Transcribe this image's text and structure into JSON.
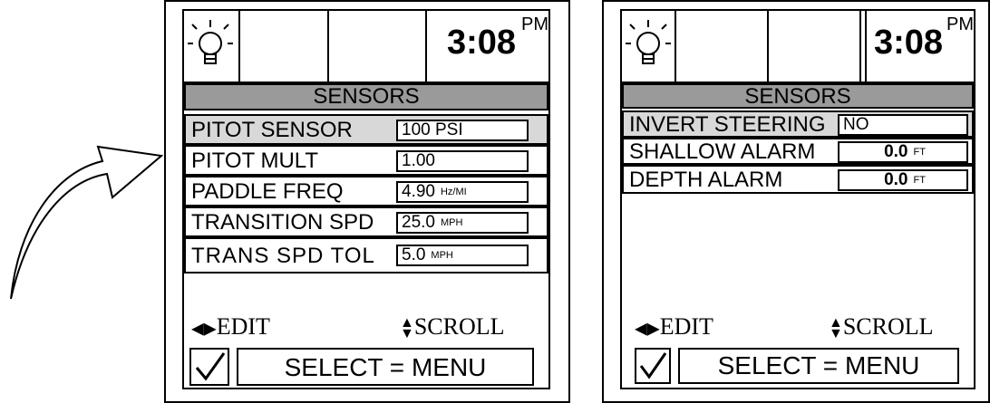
{
  "panel_left": {
    "time": "3:08",
    "ampm": "PM",
    "title": "SENSORS",
    "rows": [
      {
        "label": "PITOT SENSOR",
        "value": "100 PSI",
        "unit": ""
      },
      {
        "label": "PITOT MULT",
        "value": "1.00",
        "unit": ""
      },
      {
        "label": "PADDLE FREQ",
        "value": "4.90",
        "unit": "Hz/MI"
      },
      {
        "label": "TRANSITION SPD",
        "value": "25.0",
        "unit": "MPH"
      },
      {
        "label": "TRANS SPD TOL",
        "value": "5.0",
        "unit": "MPH"
      }
    ],
    "edit_label": "EDIT",
    "scroll_label": "SCROLL",
    "select_label": "SELECT = MENU"
  },
  "panel_right": {
    "time": "3:08",
    "ampm": "PM",
    "title": "SENSORS",
    "rows": [
      {
        "label": "INVERT STEERING",
        "value": "NO",
        "unit": ""
      },
      {
        "label": "SHALLOW ALARM",
        "value": "0.0",
        "unit": "FT"
      },
      {
        "label": "DEPTH ALARM",
        "value": "0.0",
        "unit": "FT"
      }
    ],
    "edit_label": "EDIT",
    "scroll_label": "SCROLL",
    "select_label": "SELECT = MENU"
  }
}
